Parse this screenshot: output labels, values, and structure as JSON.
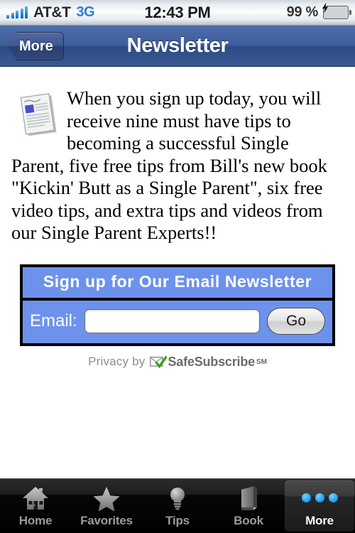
{
  "status_bar": {
    "signal_icon": "signal-bars-icon",
    "signal_strength": 5,
    "carrier": "AT&T",
    "network": "3G",
    "time": "12:43 PM",
    "battery_percent": "99 %",
    "battery_icon": "battery-charging-icon"
  },
  "nav_bar": {
    "back_label": "More",
    "title": "Newsletter"
  },
  "content": {
    "icon": "newspaper-icon",
    "promo_text": "When you sign up today, you will receive nine must have tips to becoming a successful Single Parent, five free tips from Bill's new book \"Kickin' Butt as a Single Parent\", six free video tips, and extra tips and videos from our Single Parent Experts!!"
  },
  "signup_form": {
    "header": "Sign up for Our Email Newsletter",
    "email_label": "Email:",
    "email_value": "",
    "email_placeholder": "",
    "submit_label": "Go",
    "background_color": "#6d92ec",
    "border_color": "#000000"
  },
  "safe_subscribe": {
    "prefix": "Privacy by",
    "mark_icon": "envelope-check-icon",
    "brand": "SafeSubscribe",
    "superscript": "SM",
    "check_color": "#3aa621",
    "text_color": "#6b6b6b"
  },
  "tab_bar": {
    "selected_index": 4,
    "tabs": [
      {
        "label": "Home",
        "icon": "house-icon"
      },
      {
        "label": "Favorites",
        "icon": "star-icon"
      },
      {
        "label": "Tips",
        "icon": "lightbulb-icon"
      },
      {
        "label": "Book",
        "icon": "book-icon"
      },
      {
        "label": "More",
        "icon": "three-dots-icon"
      }
    ]
  }
}
